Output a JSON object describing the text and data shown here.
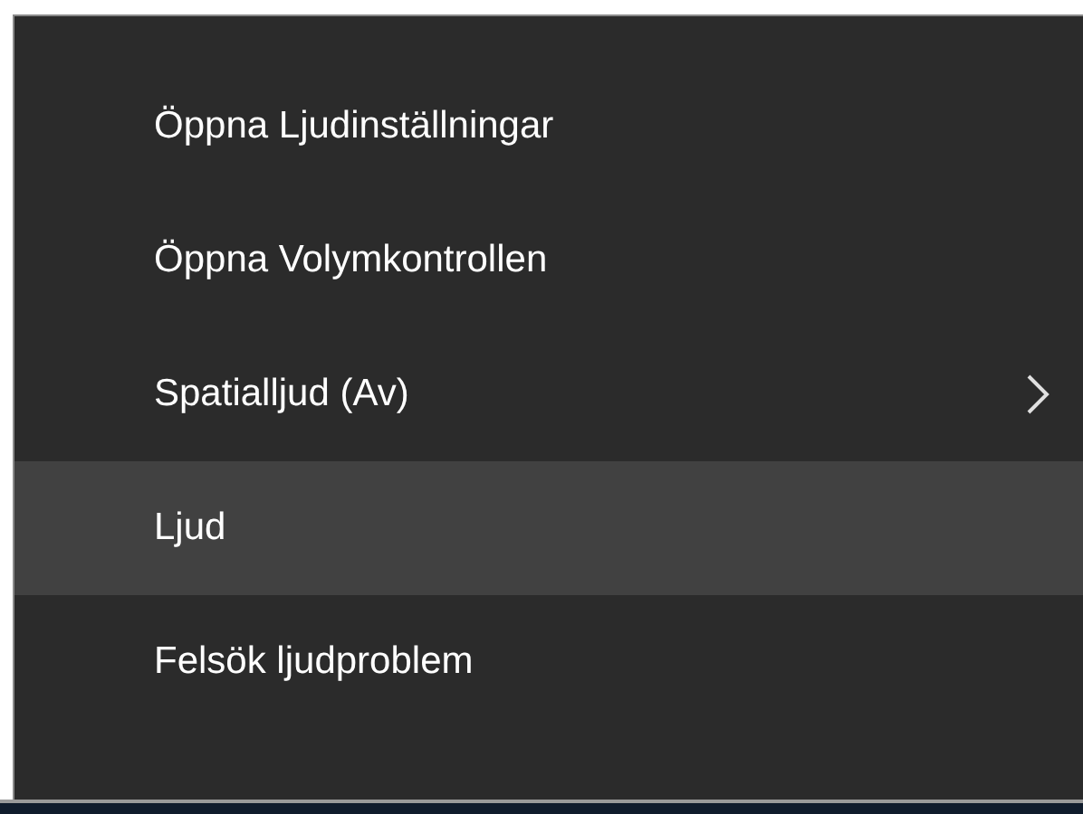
{
  "context_menu": {
    "items": [
      {
        "label": "Öppna Ljudinställningar",
        "selected": false,
        "submenu": false
      },
      {
        "label": "Öppna Volymkontrollen",
        "selected": false,
        "submenu": false
      },
      {
        "label": "Spatialljud (Av)",
        "selected": false,
        "submenu": true
      },
      {
        "label": "Ljud",
        "selected": true,
        "submenu": false
      },
      {
        "label": "Felsök ljudproblem",
        "selected": false,
        "submenu": false
      }
    ]
  }
}
